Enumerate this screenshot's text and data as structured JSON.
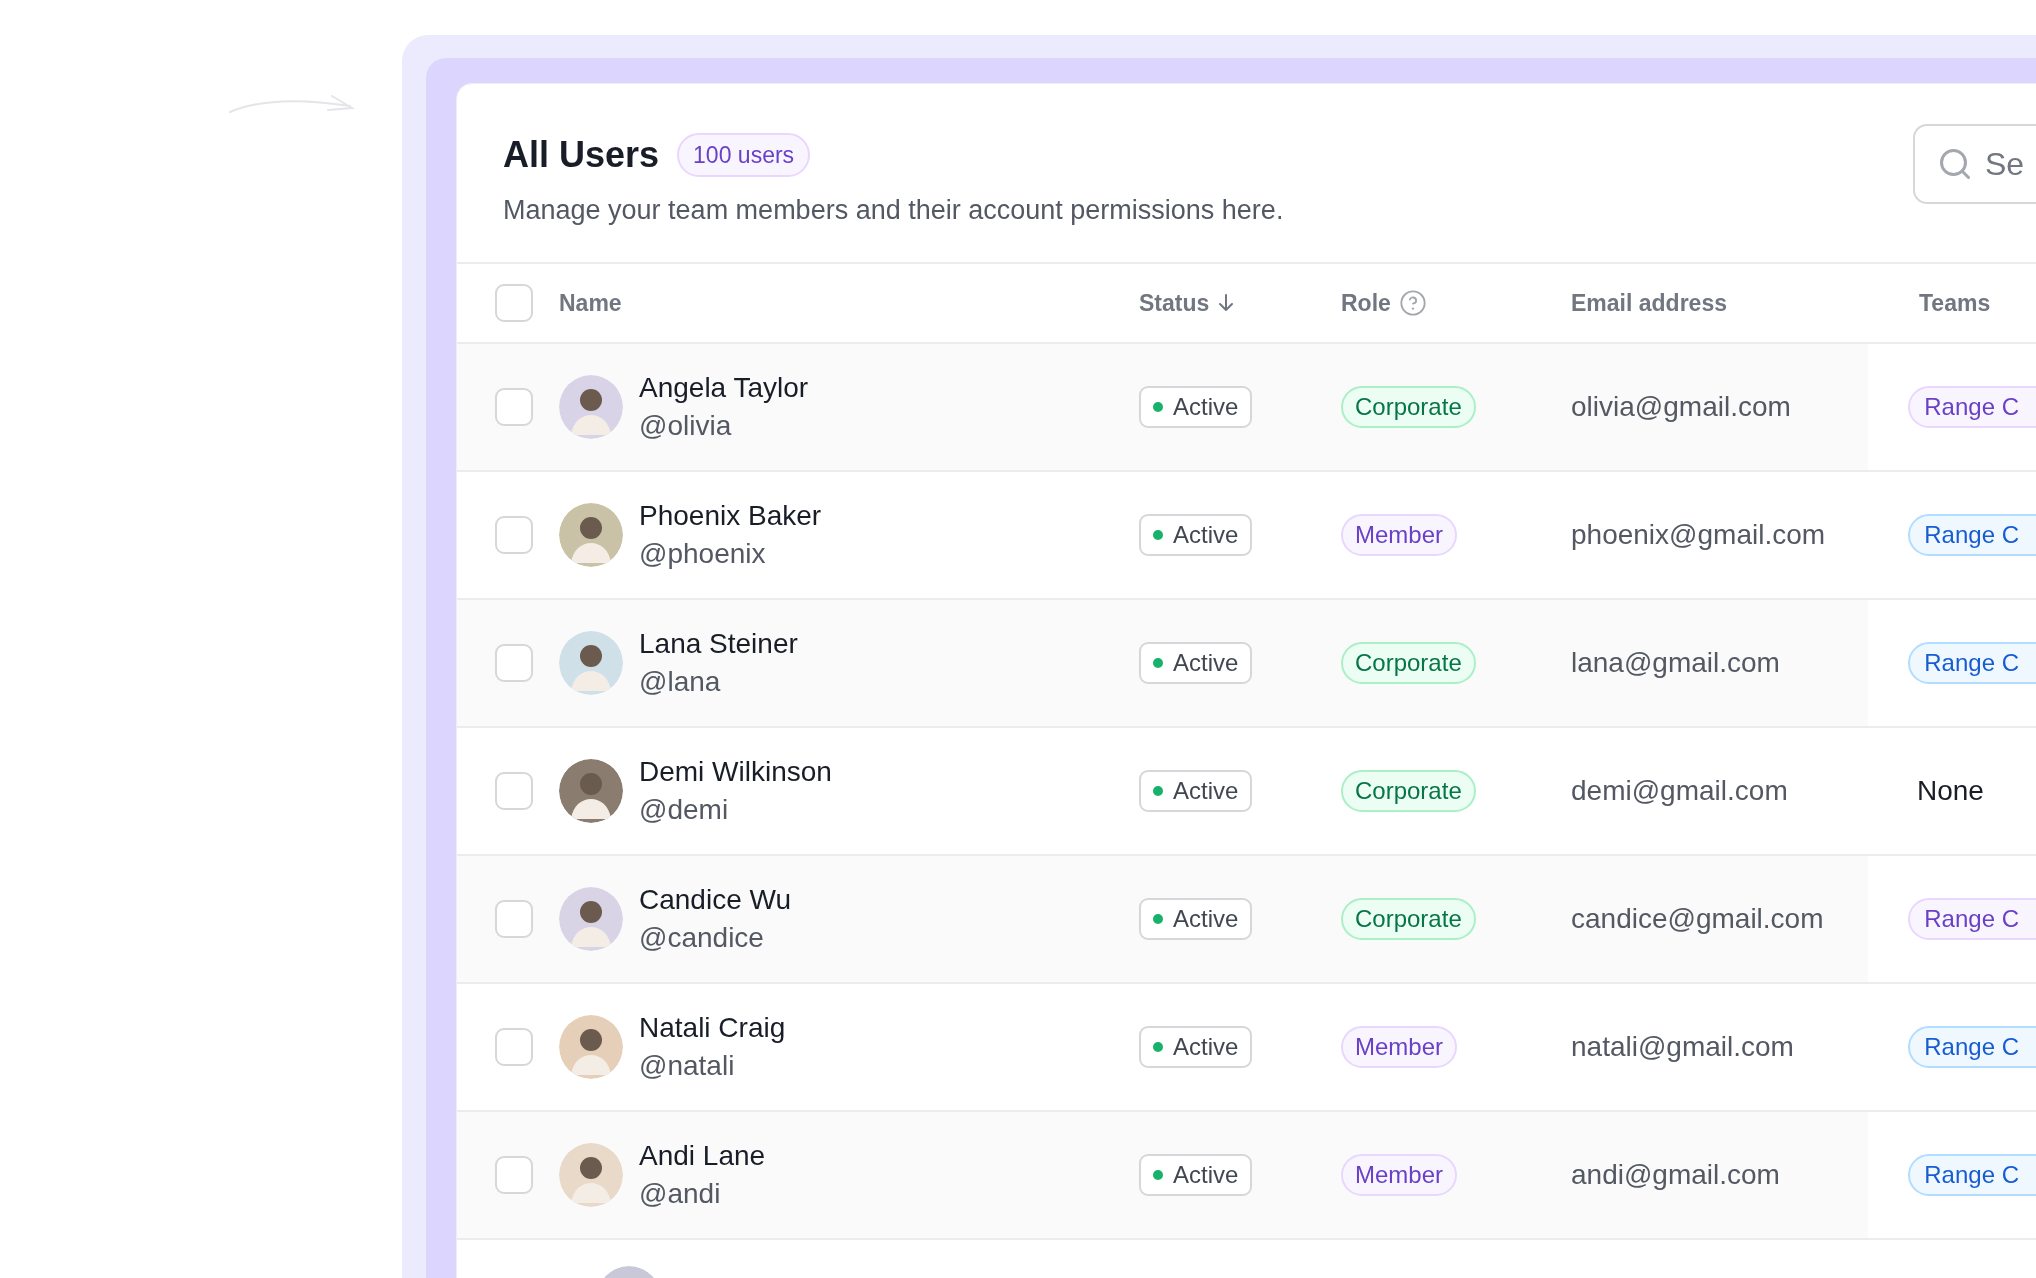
{
  "header": {
    "title": "All Users",
    "count_badge": "100 users",
    "subtitle": "Manage your team members and their account permissions here.",
    "search": {
      "placeholder": "Se"
    }
  },
  "table": {
    "select_all": {
      "checked": false
    },
    "columns": [
      {
        "label": "Name",
        "kind": "plain"
      },
      {
        "label": "Status",
        "kind": "sorted"
      },
      {
        "label": "Role",
        "kind": "help"
      },
      {
        "label": "Email address",
        "kind": "plain"
      },
      {
        "label": "Teams",
        "kind": "plain"
      }
    ],
    "rows": [
      {
        "checked": false,
        "name": "Angela Taylor",
        "handle": "@olivia",
        "status": "Active",
        "role": {
          "label": "Corporate",
          "kind": "corporate"
        },
        "email": "olivia@gmail.com",
        "team": {
          "label": "Range C",
          "kind": "purple"
        }
      },
      {
        "checked": false,
        "name": "Phoenix Baker",
        "handle": "@phoenix",
        "status": "Active",
        "role": {
          "label": "Member",
          "kind": "member"
        },
        "email": "phoenix@gmail.com",
        "team": {
          "label": "Range C",
          "kind": "blue"
        }
      },
      {
        "checked": false,
        "name": "Lana Steiner",
        "handle": "@lana",
        "status": "Active",
        "role": {
          "label": "Corporate",
          "kind": "corporate"
        },
        "email": "lana@gmail.com",
        "team": {
          "label": "Range C",
          "kind": "blue"
        }
      },
      {
        "checked": false,
        "name": "Demi Wilkinson",
        "handle": "@demi",
        "status": "Active",
        "role": {
          "label": "Corporate",
          "kind": "corporate"
        },
        "email": "demi@gmail.com",
        "team": {
          "label": "None",
          "kind": "none"
        }
      },
      {
        "checked": false,
        "name": "Candice Wu",
        "handle": "@candice",
        "status": "Active",
        "role": {
          "label": "Corporate",
          "kind": "corporate"
        },
        "email": "candice@gmail.com",
        "team": {
          "label": "Range C",
          "kind": "purple"
        }
      },
      {
        "checked": false,
        "name": "Natali Craig",
        "handle": "@natali",
        "status": "Active",
        "role": {
          "label": "Member",
          "kind": "member"
        },
        "email": "natali@gmail.com",
        "team": {
          "label": "Range C",
          "kind": "blue"
        }
      },
      {
        "checked": false,
        "name": "Andi Lane",
        "handle": "@andi",
        "status": "Active",
        "role": {
          "label": "Member",
          "kind": "member"
        },
        "email": "andi@gmail.com",
        "team": {
          "label": "Range C",
          "kind": "blue"
        }
      }
    ]
  }
}
